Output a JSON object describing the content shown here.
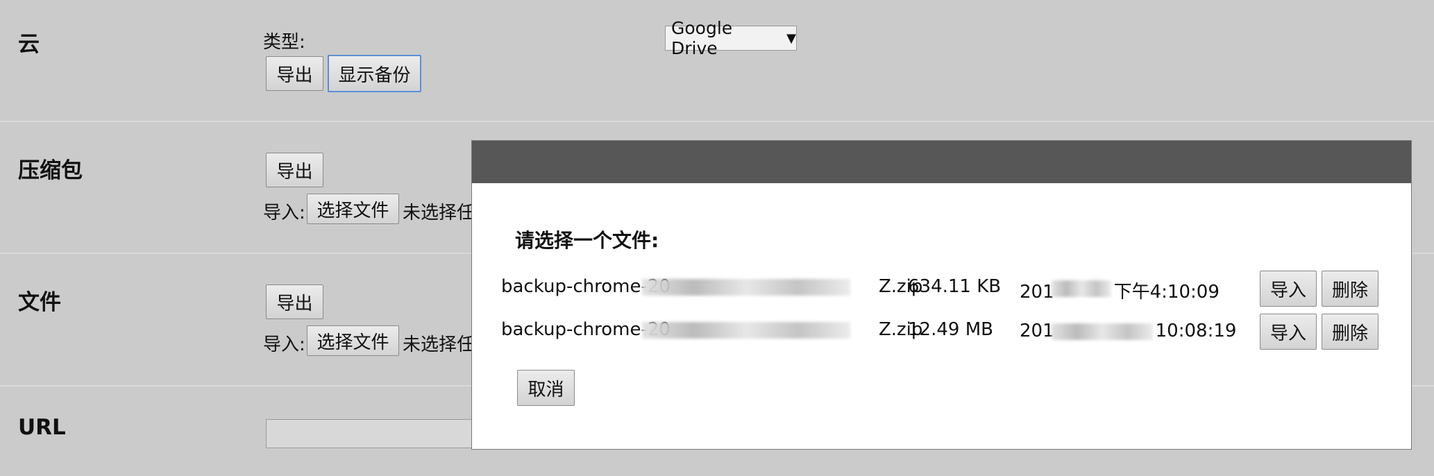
{
  "cloud": {
    "title": "云",
    "type_label": "类型:",
    "provider_selected": "Google Drive",
    "export_label": "导出",
    "show_backups_label": "显示备份"
  },
  "archive": {
    "title": "压缩包",
    "export_label": "导出",
    "import_label": "导入:",
    "choose_file_label": "选择文件",
    "no_file_text": "未选择任"
  },
  "files": {
    "title": "文件",
    "export_label": "导出",
    "import_label": "导入:",
    "choose_file_label": "选择文件",
    "no_file_text": "未选择任"
  },
  "url": {
    "title": "URL"
  },
  "modal": {
    "title": "请选择一个文件:",
    "rows": [
      {
        "name_start": "backup-chrome-20",
        "name_end": "Z.zip",
        "size": "634.11 KB",
        "date_start": "201",
        "date_end": "下午4:10:09",
        "import_label": "导入",
        "delete_label": "删除"
      },
      {
        "name_start": "backup-chrome-20",
        "name_end": "Z.zip",
        "size": "12.49 MB",
        "date_start": "201",
        "date_end": "10:08:19",
        "import_label": "导入",
        "delete_label": "删除"
      }
    ],
    "cancel_label": "取消"
  }
}
